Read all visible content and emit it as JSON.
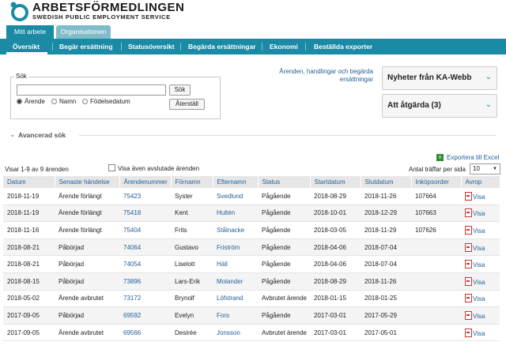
{
  "brand": {
    "title": "ARBETSFÖRMEDLINGEN",
    "subtitle": "SWEDISH PUBLIC EMPLOYMENT SERVICE",
    "colors": {
      "primary": "#1a8aa5",
      "link": "#1f5f99"
    }
  },
  "top_tabs": [
    {
      "label": "Mitt arbete",
      "active": true
    },
    {
      "label": "Organisationen",
      "active": false
    }
  ],
  "nav": [
    {
      "label": "Översikt",
      "active": true
    },
    {
      "label": "Begär ersättning"
    },
    {
      "label": "Statusöversikt"
    },
    {
      "label": "Begärda ersättningar"
    },
    {
      "label": "Ekonomi"
    },
    {
      "label": "Beställda exporter"
    }
  ],
  "search": {
    "legend": "Sök",
    "input_value": "",
    "search_button": "Sök",
    "reset_button": "Återställ",
    "radios": [
      {
        "label": "Ärende",
        "selected": true
      },
      {
        "label": "Namn",
        "selected": false
      },
      {
        "label": "Födelsedatum",
        "selected": false
      }
    ]
  },
  "top_link": "Ärenden, handlingar och begärda ersättningar",
  "panels": [
    {
      "title": "Nyheter från KA-Webb",
      "icon": "chevron-down-icon"
    },
    {
      "title": "Att åtgärda (3)",
      "icon": "chevron-down-icon"
    }
  ],
  "advanced_search": "Avancerad sök",
  "export_label": "Exportera till Excel",
  "results_summary": "Visar 1-9 av 9 ärenden",
  "show_closed_label": "Visa även avslutade ärenden",
  "per_page": {
    "label": "Antal träffar per sida",
    "value": "10"
  },
  "table": {
    "columns": [
      "Datum",
      "Senaste händelse",
      "Ärendenummer",
      "Förnamn",
      "Efternamn",
      "Status",
      "Startdatum",
      "Slutdatum",
      "Inköpsorder",
      "Avrop"
    ],
    "rows": [
      [
        "2018-11-19",
        "Ärende förlängt",
        "75423",
        "Syster",
        "Svedlund",
        "Pågående",
        "2018-08-29",
        "2018-11-26",
        "107664",
        "Visa"
      ],
      [
        "2018-11-19",
        "Ärende förlängt",
        "75418",
        "Kent",
        "Hultén",
        "Pågående",
        "2018-10-01",
        "2018-12-29",
        "107663",
        "Visa"
      ],
      [
        "2018-11-16",
        "Ärende förlängt",
        "75404",
        "Frits",
        "Stålnacke",
        "Pågående",
        "2018-03-05",
        "2018-11-29",
        "107626",
        "Visa"
      ],
      [
        "2018-08-21",
        "Påbörjad",
        "74064",
        "Gustavo",
        "Friström",
        "Pågående",
        "2018-04-06",
        "2018-07-04",
        "",
        "Visa"
      ],
      [
        "2018-08-21",
        "Påbörjad",
        "74054",
        "Liselott",
        "Häll",
        "Pågående",
        "2018-04-06",
        "2018-07-04",
        "",
        "Visa"
      ],
      [
        "2018-08-15",
        "Påbörjad",
        "73896",
        "Lars-Erik",
        "Molander",
        "Pågående",
        "2018-08-29",
        "2018-11-26",
        "",
        "Visa"
      ],
      [
        "2018-05-02",
        "Ärende avbrutet",
        "73172",
        "Brynolf",
        "Löfstrand",
        "Avbrutet ärende",
        "2018-01-15",
        "2018-01-25",
        "",
        "Visa"
      ],
      [
        "2017-09-05",
        "Påbörjad",
        "69592",
        "Evelyn",
        "Fors",
        "Pågående",
        "2017-03-01",
        "2017-05-29",
        "",
        "Visa"
      ],
      [
        "2017-09-05",
        "Ärende avbrutet",
        "69566",
        "Desirée",
        "Jonsson",
        "Avbrutet ärende",
        "2017-03-01",
        "2017-05-01",
        "",
        "Visa"
      ]
    ]
  }
}
